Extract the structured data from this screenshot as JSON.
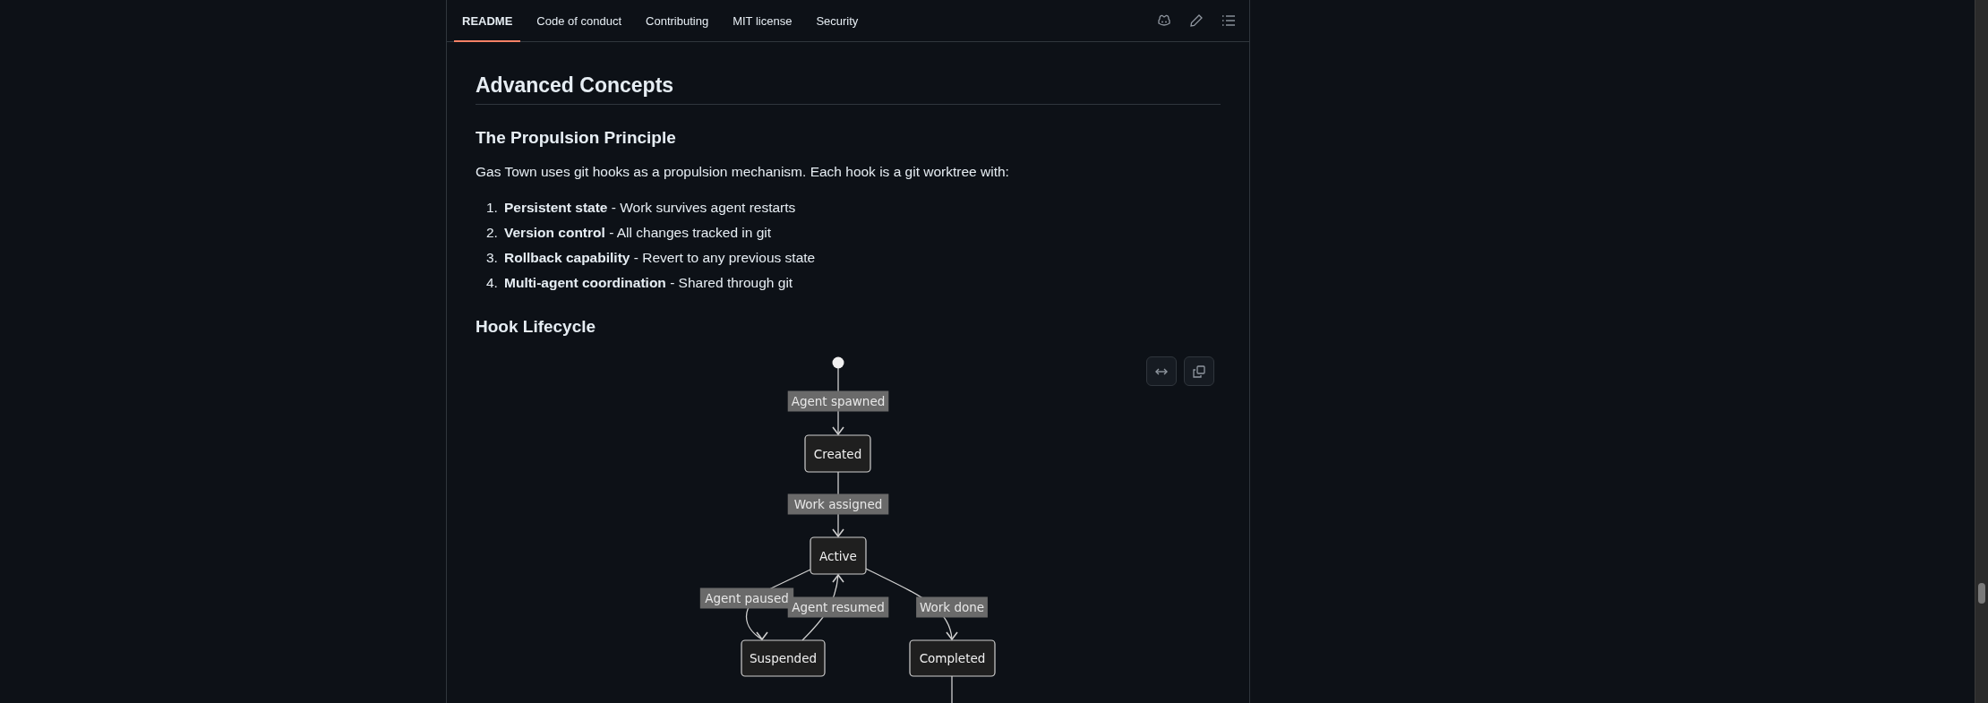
{
  "tabs": [
    {
      "label": "README",
      "selected": true
    },
    {
      "label": "Code of conduct",
      "selected": false
    },
    {
      "label": "Contributing",
      "selected": false
    },
    {
      "label": "MIT license",
      "selected": false
    },
    {
      "label": "Security",
      "selected": false
    }
  ],
  "section_title": "Advanced Concepts",
  "subsection_title": "The Propulsion Principle",
  "intro": "Gas Town uses git hooks as a propulsion mechanism. Each hook is a git worktree with:",
  "list_items": [
    {
      "marker": "1.",
      "text": "**Persistent state** - Work survives agent restarts"
    },
    {
      "marker": "2.",
      "text": "**Version control** - All changes tracked in git"
    },
    {
      "marker": "3.",
      "text": "**Rollback capability** - Revert to any previous state"
    },
    {
      "marker": "4.",
      "text": "**Multi-agent coordination** - Shared through git"
    }
  ],
  "lifecycle_title": "Hook Lifecycle",
  "diagram": {
    "states": [
      {
        "label": "Created"
      },
      {
        "label": "Active"
      },
      {
        "label": "Suspended"
      },
      {
        "label": "Completed"
      }
    ],
    "transitions": [
      {
        "label": "Agent spawned"
      },
      {
        "label": "Work assigned"
      },
      {
        "label": "Agent paused"
      },
      {
        "label": "Agent resumed"
      },
      {
        "label": "Work done"
      }
    ]
  }
}
